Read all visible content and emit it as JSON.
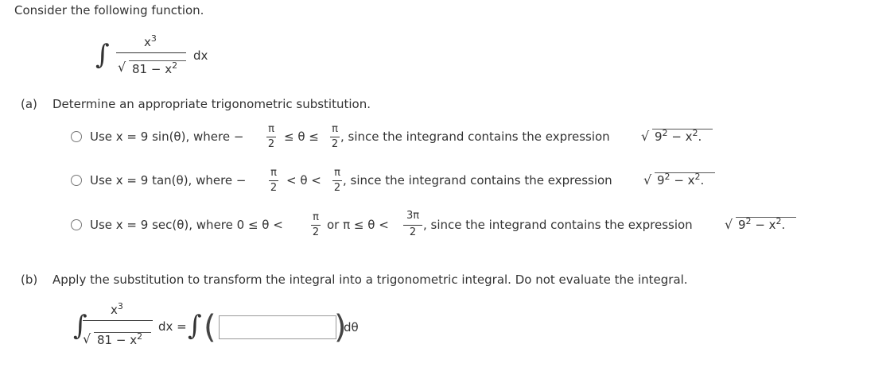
{
  "intro": "Consider the following function.",
  "integral": {
    "numerator": "x",
    "numerator_exp": "3",
    "radicand_const": "81",
    "radicand_op": "−",
    "radicand_var": "x",
    "radicand_exp": "2",
    "dx": "dx"
  },
  "part_a": {
    "label": "(a)",
    "prompt": "Determine an appropriate trigonometric substitution.",
    "options": [
      {
        "text_pre": "Use x = 9 sin(θ), where −",
        "ineq": "≤ θ ≤",
        "text_post": ", since the integrand contains the expression",
        "expr_base": "9",
        "expr_exp": "2",
        "expr_mid": " − x",
        "expr_exp2": "2",
        "expr_end": "."
      },
      {
        "text_pre": "Use x = 9 tan(θ), where −",
        "ineq": "< θ <",
        "text_post": ", since the integrand contains the expression",
        "expr_base": "9",
        "expr_exp": "2",
        "expr_mid": " − x",
        "expr_exp2": "2",
        "expr_end": "."
      },
      {
        "text_pre": "Use x = 9 sec(θ), where 0 ≤ θ <",
        "mid": "or π ≤ θ <",
        "text_post": ", since the integrand contains the expression",
        "expr_base": "9",
        "expr_exp": "2",
        "expr_mid": " − x",
        "expr_exp2": "2",
        "expr_end": "."
      }
    ],
    "pi": "π",
    "two": "2",
    "three_pi": "3π"
  },
  "part_b": {
    "label": "(b)",
    "prompt": "Apply the substitution to transform the integral into a trigonometric integral. Do not evaluate the integral.",
    "equals": "dx =",
    "dtheta": "dθ"
  }
}
